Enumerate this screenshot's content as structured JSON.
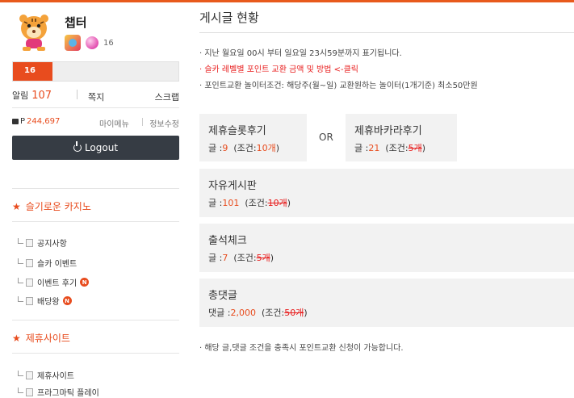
{
  "profile": {
    "username": "챕터",
    "level_num": "16",
    "level_bar": "16",
    "level_progress": 0.24
  },
  "stats": {
    "alarm_label": "알림",
    "alarm_count": "107",
    "memo_label": "쪽지",
    "scrap_label": "스크랩"
  },
  "points": {
    "label": "P",
    "value": "244,697",
    "my_menu": "마이메뉴",
    "edit_info": "정보수정"
  },
  "logout": {
    "label": "Logout"
  },
  "sidebar": {
    "section1": {
      "title": "슬기로운 카지노",
      "items": [
        {
          "label": "공지사항",
          "new": ""
        },
        {
          "label": "슬카 이벤트",
          "new": ""
        },
        {
          "label": "이벤트 후기",
          "new": "N"
        },
        {
          "label": "배당왕",
          "new": "N"
        }
      ]
    },
    "section2": {
      "title": "제휴사이트",
      "items": [
        {
          "label": "제휴사이트"
        },
        {
          "label": "프라그마틱 플레이"
        }
      ]
    }
  },
  "main": {
    "title": "게시글 현황",
    "notices": [
      "· 지난 월요일 00시 부터 일요일 23시59분까지 표기됩니다.",
      "· 슬카 레벨별 포인트 교환 금액 및 방법 <-클릭",
      "· 포인트교환 놀이터조건: 해당주(월~일) 교환원하는 놀이터(1개기준) 최소50만원"
    ],
    "or_label": "OR",
    "boards": [
      {
        "name": "제휴슬롯후기",
        "prefix": "글 :",
        "count": "9",
        "cond_prefix": "(조건:",
        "cond": "10개",
        "cond_suffix": ")"
      },
      {
        "name": "제휴바카라후기",
        "prefix": "글 :",
        "count": "21",
        "cond_prefix": "(조건:",
        "cond": "5개",
        "cond_suffix": ")"
      },
      {
        "name": "자유게시판",
        "prefix": "글 :",
        "count": "101",
        "cond_prefix": "(조건:",
        "cond": "10개",
        "cond_suffix": ")"
      },
      {
        "name": "출석체크",
        "prefix": "글 :",
        "count": "7",
        "cond_prefix": "(조건:",
        "cond": "5개",
        "cond_suffix": ")"
      },
      {
        "name": "총댓글",
        "prefix": "댓글 :",
        "count": "2,000",
        "cond_prefix": "(조건:",
        "cond": "50개",
        "cond_suffix": ")"
      }
    ],
    "footer_note": "· 해당 글,댓글 조건을 충족시 포인트교환 신청이 가능합니다."
  },
  "colors": {
    "accent": "#e84c1e",
    "dark_button": "#363c44",
    "box_bg": "#f2f2f2",
    "notice_red": "#e81c1c"
  }
}
